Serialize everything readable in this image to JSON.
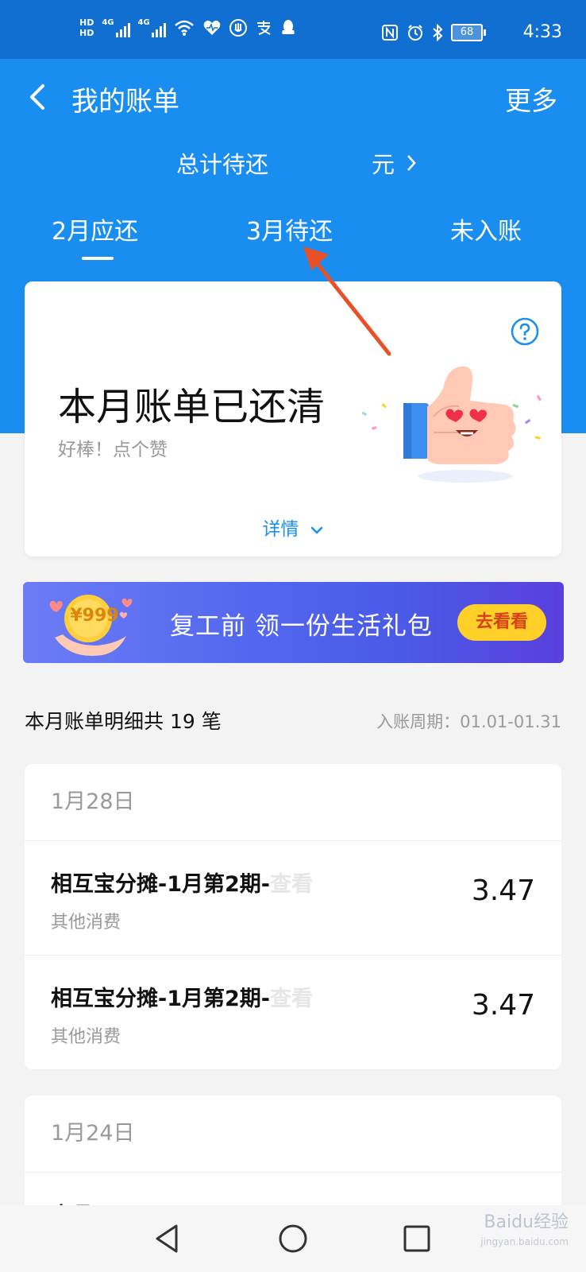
{
  "status_bar": {
    "hd_labels": [
      "HD",
      "HD"
    ],
    "network_labels": [
      "4G",
      "4G"
    ],
    "battery": "68",
    "time": "4:33",
    "icons": [
      "wifi-icon",
      "heart-icon",
      "hand-icon",
      "alipay-icon",
      "qq-icon",
      "nfc-icon",
      "alarm-icon",
      "bluetooth-icon"
    ]
  },
  "header": {
    "title": "我的账单",
    "more": "更多"
  },
  "total": {
    "label": "总计待还",
    "unit": "元"
  },
  "tabs": [
    {
      "label": "2月应还",
      "active": true
    },
    {
      "label": "3月待还",
      "active": false
    },
    {
      "label": "未入账",
      "active": false
    }
  ],
  "status_card": {
    "title": "本月账单已还清",
    "subtitle": "好棒！点个赞",
    "details": "详情"
  },
  "banner": {
    "coin": "¥999",
    "text": "复工前 领一份生活礼包",
    "button": "去看看"
  },
  "list_header": {
    "summary": "本月账单明细共 19 笔",
    "period": "入账周期：01.01-01.31"
  },
  "groups": [
    {
      "date": "1月28日",
      "rows": [
        {
          "title": "相互宝分摊-1月第2期-",
          "title_faded": "查看",
          "category": "其他消费",
          "amount": "3.47"
        },
        {
          "title": "相互宝分摊-1月第2期-",
          "title_faded": "查看",
          "category": "其他消费",
          "amount": "3.47"
        }
      ]
    },
    {
      "date": "1月24日",
      "rows": [
        {
          "title": "商品",
          "category": ""
        }
      ]
    }
  ],
  "watermark": {
    "brand": "Baidu经验",
    "url": "jingyan.baidu.com"
  },
  "colors": {
    "primary_blue": "#1a8ef0",
    "status_bar_blue": "#106fd0",
    "accent_red": "#e8502a",
    "banner_button": "#ffd027"
  }
}
